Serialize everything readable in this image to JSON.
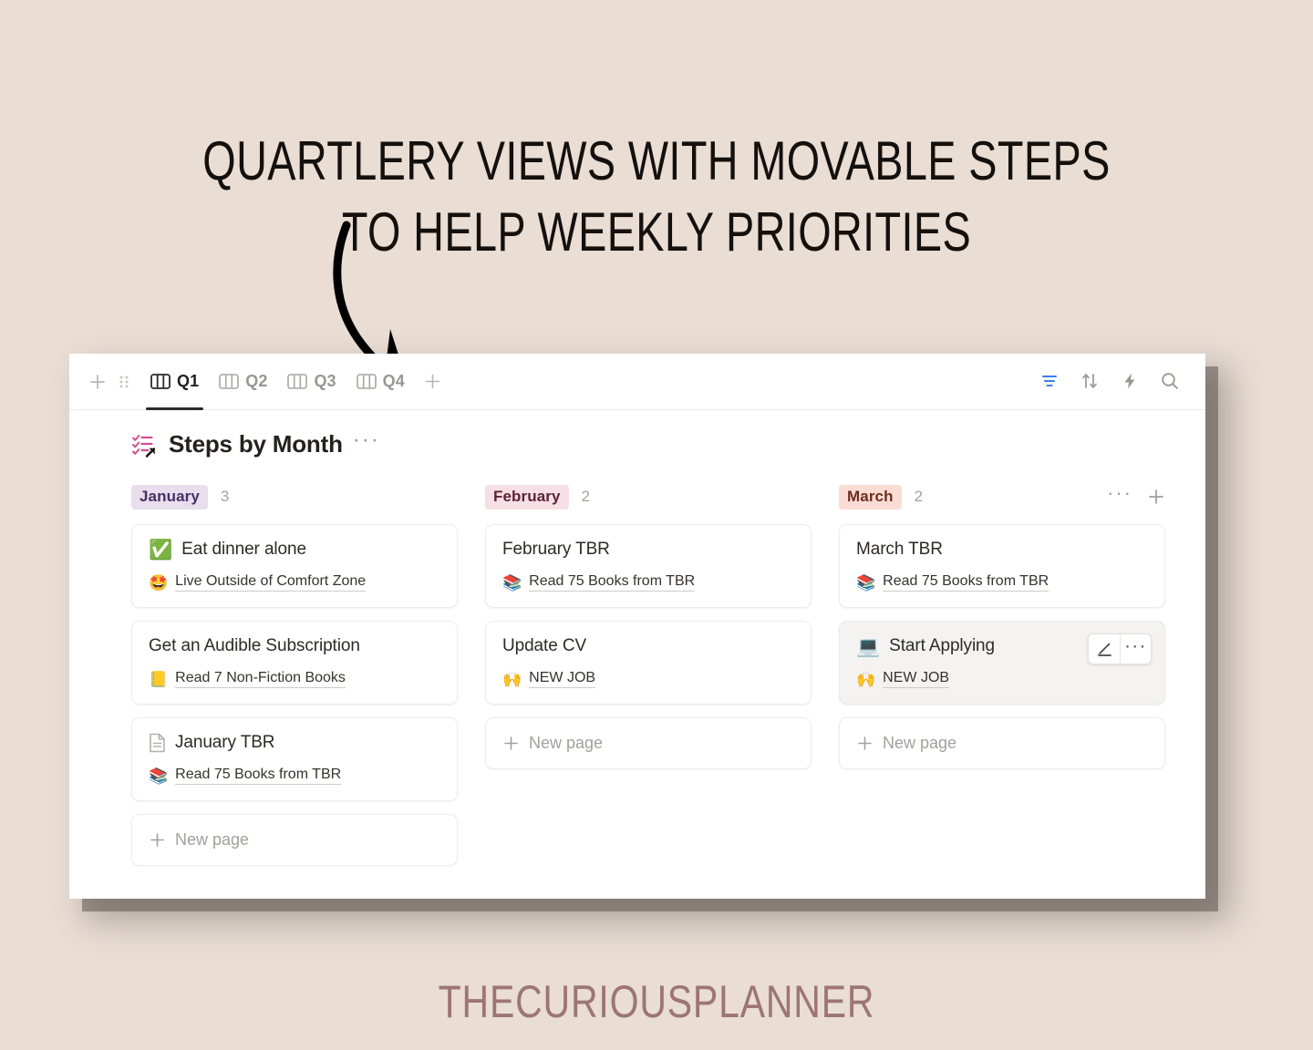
{
  "page": {
    "headline": "QUARTLERY VIEWS WITH MOVABLE STEPS TO HELP WEEKLY PRIORITIES",
    "footer_brand": "THECURIOUSPLANNER",
    "background_color": "#e9ddd4",
    "headline_color": "#14100e",
    "footer_color": "#9d7671",
    "arrow": "curved-down-right-arrow"
  },
  "toolbar": {
    "add_view_label": "+",
    "drag_handle": "drag-handle-icon",
    "tabs": [
      {
        "label": "Q1",
        "icon": "board-view-icon",
        "active": true
      },
      {
        "label": "Q2",
        "icon": "board-view-icon",
        "active": false
      },
      {
        "label": "Q3",
        "icon": "board-view-icon",
        "active": false
      },
      {
        "label": "Q4",
        "icon": "board-view-icon",
        "active": false
      }
    ],
    "add_tab_label": "+",
    "actions": [
      {
        "name": "filter-icon",
        "active": true,
        "color": "#3b7ff0"
      },
      {
        "name": "sort-icon",
        "active": false
      },
      {
        "name": "automation-lightning-icon",
        "active": false
      },
      {
        "name": "search-icon",
        "active": false
      }
    ]
  },
  "board": {
    "icon": "linked-checklist-view-icon",
    "title": "Steps by Month",
    "more_label": "···",
    "columns": [
      {
        "name": "January",
        "chip_class": "january",
        "count": "3",
        "chip_bg": "#e8deee",
        "chip_color": "#473063",
        "new_page_label": "New page",
        "cards": [
          {
            "emoji": "✅",
            "icon": "",
            "title": "Eat dinner alone",
            "relation_emoji": "🤩",
            "relation_text": "Live Outside of Comfort Zone",
            "hovered": false
          },
          {
            "emoji": "",
            "icon": "",
            "title": "Get an Audible Subscription",
            "relation_emoji": "📒",
            "relation_text": "Read 7 Non-Fiction Books",
            "hovered": false
          },
          {
            "emoji": "",
            "icon": "page-doc-icon",
            "title": "January TBR",
            "relation_emoji": "📚",
            "relation_text": "Read 75 Books from TBR",
            "hovered": false
          }
        ]
      },
      {
        "name": "February",
        "chip_class": "february",
        "count": "2",
        "chip_bg": "#f7dfe6",
        "chip_color": "#5c2436",
        "new_page_label": "New page",
        "cards": [
          {
            "emoji": "",
            "icon": "",
            "title": "February TBR",
            "relation_emoji": "📚",
            "relation_text": "Read 75 Books from TBR",
            "hovered": false
          },
          {
            "emoji": "",
            "icon": "",
            "title": "Update CV",
            "relation_emoji": "🙌",
            "relation_text": "NEW JOB",
            "hovered": false
          }
        ]
      },
      {
        "name": "March",
        "chip_class": "march",
        "count": "2",
        "chip_bg": "#fbdcd4",
        "chip_color": "#6d2e1f",
        "new_page_label": "New page",
        "header_more_label": "···",
        "header_plus_label": "+",
        "cards": [
          {
            "emoji": "",
            "icon": "",
            "title": "March TBR",
            "relation_emoji": "📚",
            "relation_text": "Read 75 Books from TBR",
            "hovered": false
          },
          {
            "emoji": "💻",
            "icon": "",
            "title": "Start Applying",
            "relation_emoji": "🙌",
            "relation_text": "NEW JOB",
            "hovered": true,
            "actions": [
              {
                "name": "edit-pencil-icon"
              },
              {
                "name": "more-options-icon",
                "label": "···"
              }
            ]
          }
        ]
      }
    ]
  }
}
